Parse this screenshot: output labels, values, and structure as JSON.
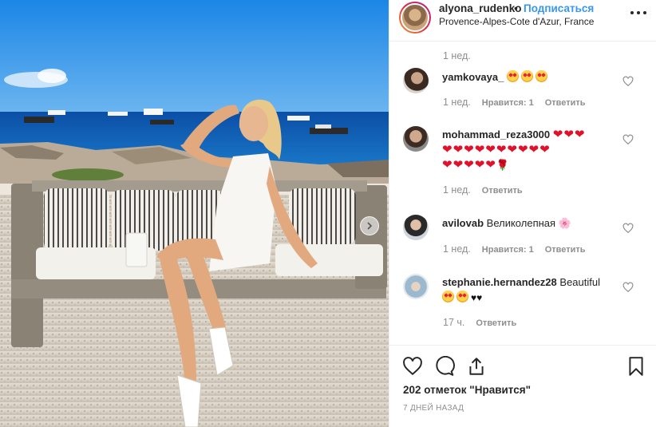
{
  "post": {
    "username": "alyona_rudenko",
    "separator": "•",
    "follow_label": "Подписаться",
    "location": "Provence-Alpes-Cote d'Azur, France",
    "top_time": "1 нед.",
    "likes_text": "202 отметок \"Нравится\"",
    "date_text": "7 ДНЕЙ НАЗАД",
    "photo_alt": "photo"
  },
  "comments": [
    {
      "user": "yamkovaya_",
      "emojis": 3,
      "time": "1 нед.",
      "likes_label": "Нравится: 1",
      "reply_label": "Ответить"
    },
    {
      "user": "mohammad_reza3000",
      "hearts_line1": "❤❤❤",
      "hearts_line2": "❤❤❤❤❤❤❤❤❤❤",
      "hearts_line3": "❤❤❤❤❤",
      "rose": "🌹",
      "time": "1 нед.",
      "reply_label": "Ответить"
    },
    {
      "user": "avilovab",
      "text": "Великолепная",
      "flower": "🌸",
      "time": "1 нед.",
      "likes_label": "Нравится: 1",
      "reply_label": "Ответить"
    },
    {
      "user": "stephanie.hernandez28",
      "text": "Beautiful",
      "emojis": 2,
      "black_hearts": "♥♥",
      "time": "17 ч.",
      "reply_label": "Ответить"
    }
  ],
  "icons": {
    "like": "heart-outline-icon",
    "comment": "comment-bubble-icon",
    "share": "share-icon",
    "save": "bookmark-icon",
    "more": "more-dots-icon",
    "next": "chevron-right-icon"
  },
  "colors": {
    "link": "#3897f0",
    "muted": "#8e8e8e",
    "text": "#262626",
    "heart": "#e0112b"
  }
}
